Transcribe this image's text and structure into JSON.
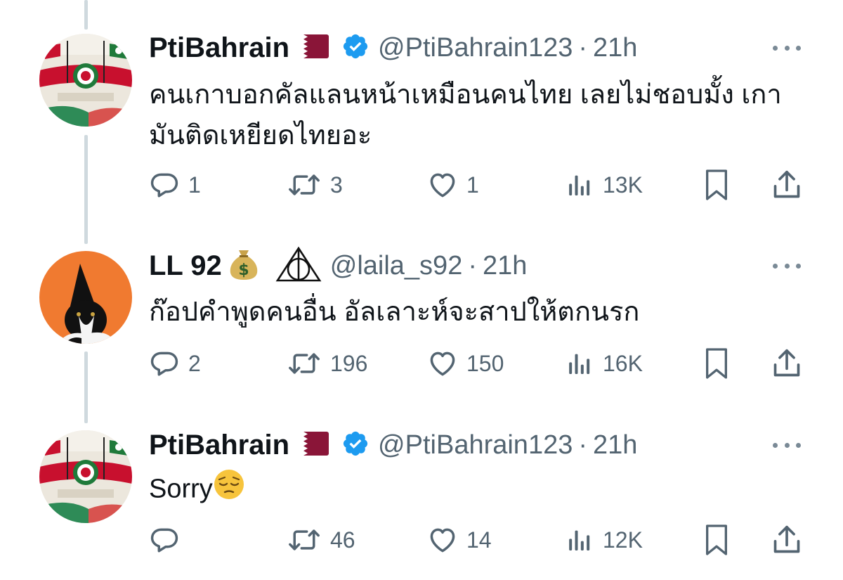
{
  "tweets": [
    {
      "display_name": "PtiBahrain",
      "flag_icon": "qatar-flag-icon",
      "verified": true,
      "handle": "@PtiBahrain123",
      "separator": "·",
      "time": "21h",
      "text": "คนเกาบอกคัลแลนหน้าเหมือนคนไทย เลยไม่ชอบมั้ง เกามันติดเหยียดไทยอะ",
      "replies": "1",
      "reposts": "3",
      "likes": "1",
      "views": "13K"
    },
    {
      "display_name": "LL 92",
      "name_emoji": "money-bag-icon",
      "name_symbol": "deathly-hallows-icon",
      "verified": false,
      "handle": "@laila_s92",
      "separator": "·",
      "time": "21h",
      "text": "ก๊อปคำพูดคนอื่น อัลเลาะห์จะสาปให้ตกนรก",
      "replies": "2",
      "reposts": "196",
      "likes": "150",
      "views": "16K"
    },
    {
      "display_name": "PtiBahrain",
      "flag_icon": "qatar-flag-icon",
      "verified": true,
      "handle": "@PtiBahrain123",
      "separator": "·",
      "time": "21h",
      "text": "Sorry",
      "text_emoji": "pensive-face-icon",
      "replies": "",
      "reposts": "46",
      "likes": "14",
      "views": "12K"
    }
  ],
  "colors": {
    "text": "#0f1419",
    "secondary": "#536471",
    "verified": "#1d9bf0",
    "thread_line": "#cfd9de",
    "orange_avatar": "#f07a30"
  }
}
